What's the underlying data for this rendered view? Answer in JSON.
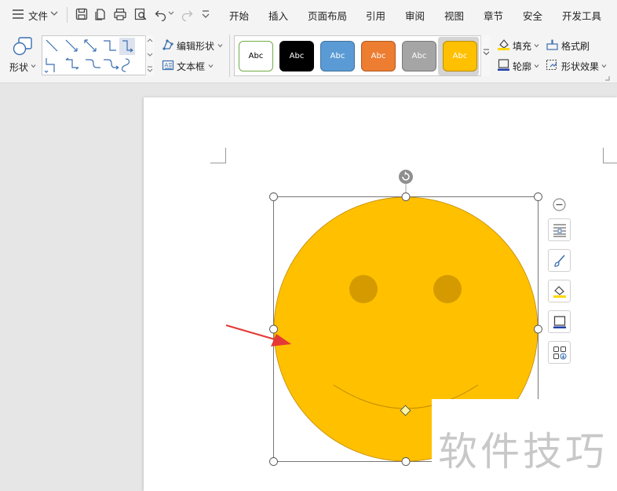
{
  "menubar": {
    "file": "文件",
    "tabs": [
      "开始",
      "插入",
      "页面布局",
      "引用",
      "审阅",
      "视图",
      "章节",
      "安全",
      "开发工具"
    ]
  },
  "ribbon": {
    "shape_label": "形状",
    "edit_shape": "编辑形状",
    "text_box": "文本框",
    "style_swatches": [
      {
        "label": "Abc",
        "fill": "#ffffff",
        "border": "#70ad47",
        "text": "#000000"
      },
      {
        "label": "Abc",
        "fill": "#000000",
        "border": "#000000",
        "text": "#ffffff"
      },
      {
        "label": "Abc",
        "fill": "#5b9bd5",
        "border": "#41719c",
        "text": "#ffffff"
      },
      {
        "label": "Abc",
        "fill": "#ed7d31",
        "border": "#ae5a21",
        "text": "#ffffff"
      },
      {
        "label": "Abc",
        "fill": "#a5a5a5",
        "border": "#787878",
        "text": "#ffffff"
      },
      {
        "label": "Abc",
        "fill": "#ffc000",
        "border": "#bc8c00",
        "text": "#ffffff"
      }
    ],
    "fill": "填充",
    "outline": "轮廓",
    "format_painter": "格式刷",
    "shape_effects": "形状效果"
  },
  "shape": {
    "name": "smiley-face",
    "fill_color": "#ffc000",
    "eye_color": "#d49a00",
    "stroke_color": "#c08a00"
  },
  "watermark": "软件技巧"
}
